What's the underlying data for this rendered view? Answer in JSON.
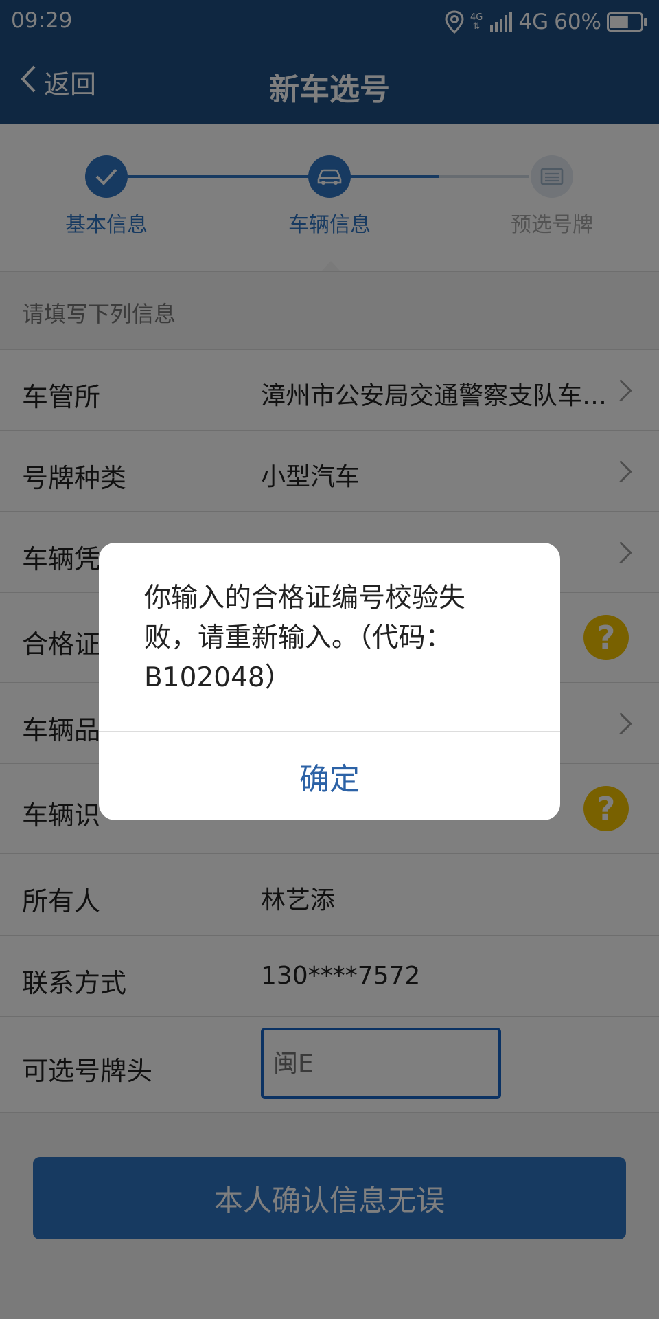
{
  "status_bar": {
    "time": "09:29",
    "net_small": "4G",
    "net_arrows": "⇅",
    "network": "4G",
    "battery": "60%",
    "battery_level": 0.6
  },
  "nav": {
    "back_label": "返回",
    "title": "新车选号"
  },
  "steps": [
    {
      "label": "基本信息",
      "state": "done"
    },
    {
      "label": "车辆信息",
      "state": "current"
    },
    {
      "label": "预选号牌",
      "state": "pending"
    }
  ],
  "form": {
    "hint": "请填写下列信息",
    "rows": [
      {
        "label": "车管所",
        "value": "漳州市公安局交通警察支队车…"
      },
      {
        "label": "号牌种类",
        "value": "小型汽车"
      },
      {
        "label": "车辆凭",
        "value": ""
      },
      {
        "label": "合格证",
        "value": ""
      },
      {
        "label": "车辆品",
        "value": ""
      },
      {
        "label": "车辆识",
        "value": ""
      },
      {
        "label": "所有人",
        "value": "林艺添"
      },
      {
        "label": "联系方式",
        "value": "130****7572"
      },
      {
        "label": "可选号牌头",
        "value": "闽E"
      }
    ],
    "help_glyph": "?",
    "confirm_label": "本人确认信息无误"
  },
  "dialog": {
    "message": "你输入的合格证编号校验失败，请重新输入。（代码：B102048）",
    "ok_label": "确定"
  },
  "colors": {
    "primary": "#1e4e82",
    "accent": "#2f74c3",
    "help": "#f3c200"
  }
}
